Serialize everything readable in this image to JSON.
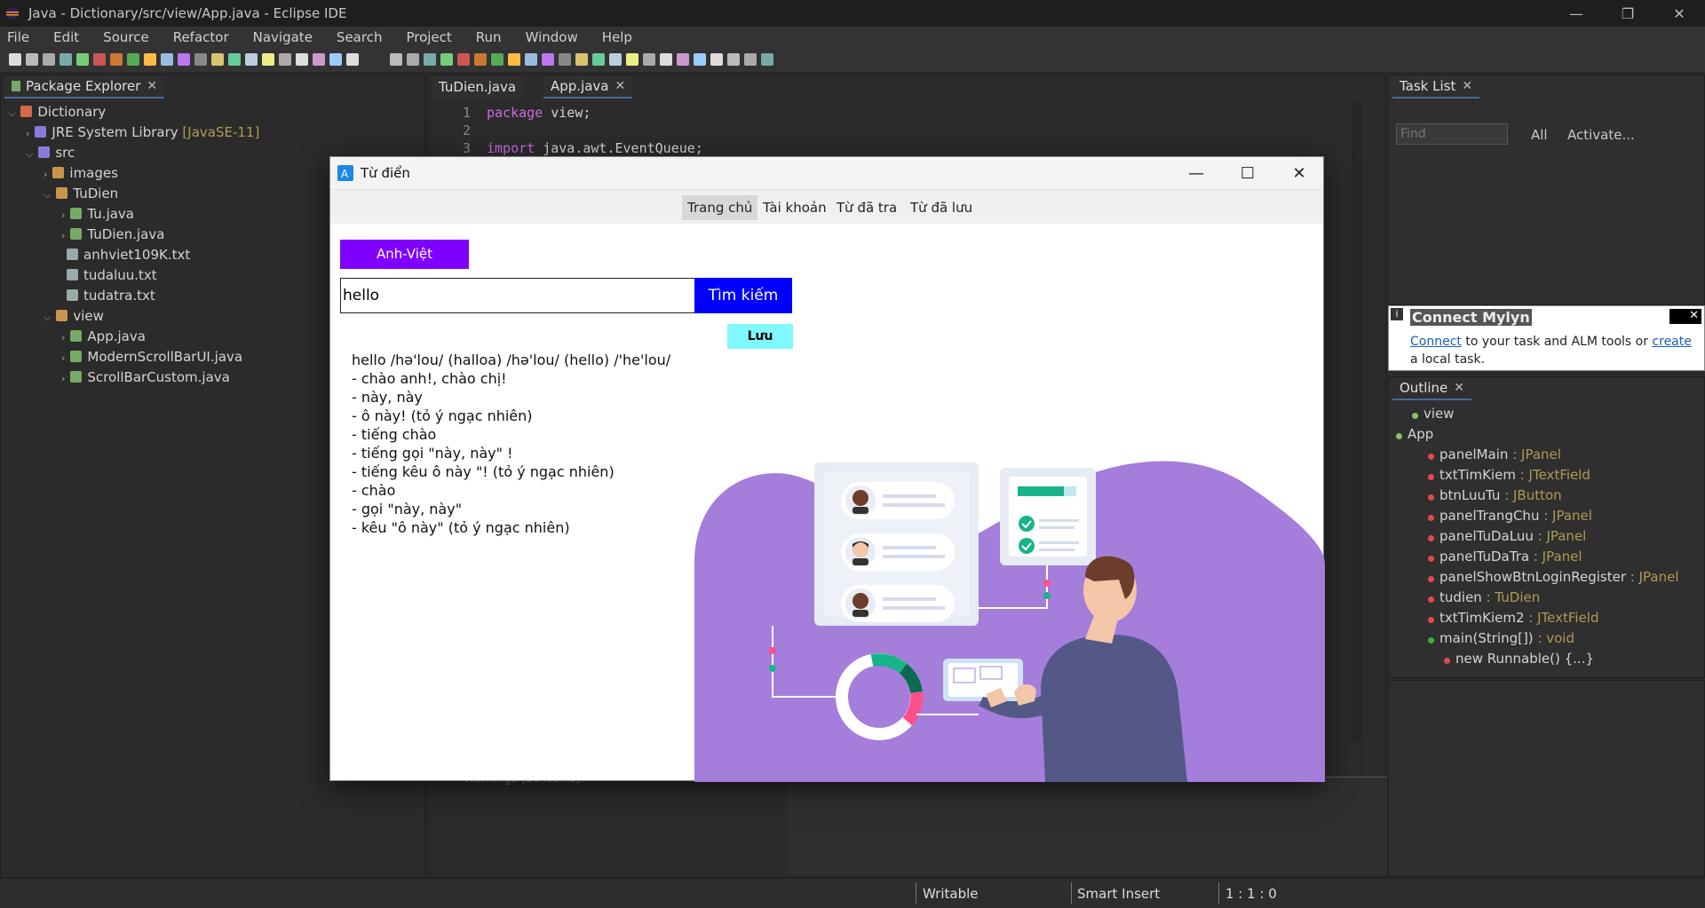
{
  "window": {
    "title": "Java - Dictionary/src/view/App.java - Eclipse IDE"
  },
  "menu": [
    "File",
    "Edit",
    "Source",
    "Refactor",
    "Navigate",
    "Search",
    "Project",
    "Run",
    "Window",
    "Help"
  ],
  "package_explorer": {
    "title": "Package Explorer",
    "tree": [
      {
        "label": "Dictionary",
        "suffix": "",
        "level": 0,
        "arrow": "open"
      },
      {
        "label": "JRE System Library ",
        "suffix": "[JavaSE-11]",
        "level": 1,
        "arrow": "closed"
      },
      {
        "label": "src",
        "suffix": "",
        "level": 1,
        "arrow": "open"
      },
      {
        "label": "images",
        "suffix": "",
        "level": 2,
        "arrow": "closed"
      },
      {
        "label": "TuDien",
        "suffix": "",
        "level": 2,
        "arrow": "open"
      },
      {
        "label": "Tu.java",
        "suffix": "",
        "level": 3,
        "arrow": "closed"
      },
      {
        "label": "TuDien.java",
        "suffix": "",
        "level": 3,
        "arrow": "closed"
      },
      {
        "label": "anhviet109K.txt",
        "suffix": "",
        "level": 3,
        "arrow": "none"
      },
      {
        "label": "tudaluu.txt",
        "suffix": "",
        "level": 3,
        "arrow": "none"
      },
      {
        "label": "tudatra.txt",
        "suffix": "",
        "level": 3,
        "arrow": "none"
      },
      {
        "label": "view",
        "suffix": "",
        "level": 2,
        "arrow": "open"
      },
      {
        "label": "App.java",
        "suffix": "",
        "level": 3,
        "arrow": "closed"
      },
      {
        "label": "ModernScrollBarUI.java",
        "suffix": "",
        "level": 3,
        "arrow": "closed"
      },
      {
        "label": "ScrollBarCustom.java",
        "suffix": "",
        "level": 3,
        "arrow": "closed"
      }
    ]
  },
  "editor": {
    "tabs": [
      "TuDien.java",
      "App.java"
    ],
    "lines": [
      {
        "num": "1",
        "kw": "package",
        "rest": " view;"
      },
      {
        "num": "2",
        "kw": "",
        "rest": ""
      },
      {
        "num": "3",
        "kw": "import",
        "rest": " java.awt.EventQueue;"
      }
    ],
    "bottom_text": "Warnings (20 items)"
  },
  "task_list": {
    "title": "Task List",
    "find_placeholder": "Find",
    "all": "All",
    "activate": "Activate..."
  },
  "mylyn": {
    "title": "Connect Mylyn",
    "connect": "Connect",
    "text1": " to your task and ALM tools or ",
    "create": "create",
    "text2": " a local task."
  },
  "outline": {
    "title": "Outline",
    "items": [
      {
        "name": "view",
        "type": ""
      },
      {
        "name": "App",
        "type": ""
      },
      {
        "name": "panelMain",
        "type": " : JPanel"
      },
      {
        "name": "txtTimKiem",
        "type": " : JTextField"
      },
      {
        "name": "btnLuuTu",
        "type": " : JButton"
      },
      {
        "name": "panelTrangChu",
        "type": " : JPanel"
      },
      {
        "name": "panelTuDaLuu",
        "type": " : JPanel"
      },
      {
        "name": "panelTuDaTra",
        "type": " : JPanel"
      },
      {
        "name": "panelShowBtnLoginRegister",
        "type": " : JPanel"
      },
      {
        "name": "tudien",
        "type": " : TuDien"
      },
      {
        "name": "txtTimKiem2",
        "type": " : JTextField"
      },
      {
        "name": "main(String[])",
        "type": " : void"
      },
      {
        "name": "new Runnable() {...}",
        "type": ""
      }
    ]
  },
  "status": {
    "writable": "Writable",
    "insert": "Smart Insert",
    "position": "1 : 1 : 0"
  },
  "dialog": {
    "title": "Từ điển",
    "tabs": [
      "Trang chủ",
      "Tài khoản",
      "Từ đã tra",
      "Từ đã lưu"
    ],
    "lang_button": "Anh-Việt",
    "search_value": "hello",
    "search_button": "Tìm kiếm",
    "save_button": "Lưu",
    "definition": [
      "hello /hə'lou/ (halloa) /hə'lou/ (hello) /'he'lou/",
      "- chào anh!, chào chị!",
      "- này, này",
      "- ô này! (tỏ ý ngạc nhiên)",
      "- tiếng chào",
      "- tiếng gọi \"này, này\" !",
      "- tiếng kêu ô này \"! (tỏ ý ngạc nhiên)",
      "- chào",
      "- gọi \"này, này\"",
      "- kêu \"ô này\" (tỏ ý ngạc nhiên)"
    ]
  },
  "colors": {
    "accent_purple": "#8000ff",
    "search_blue": "#0000ff",
    "save_cyan": "#7ff8ff",
    "illustration_purple": "#a57ddb"
  }
}
